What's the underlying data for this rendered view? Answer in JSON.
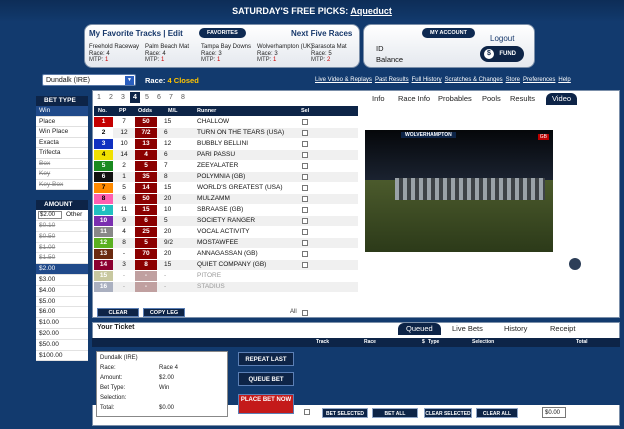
{
  "header": {
    "promo": "SATURDAY'S FREE PICKS:",
    "promo_link": "Aqueduct"
  },
  "favorites": {
    "title": "My Favorite Tracks | Edit",
    "pill": "FAVORITES",
    "next_title": "Next Five Races",
    "tracks": [
      {
        "name": "Freehold Raceway",
        "race": "Race: 4",
        "mtp": "1"
      },
      {
        "name": "Palm Beach Mat",
        "race": "Race: 4",
        "mtp": "1"
      },
      {
        "name": "Tampa Bay Downs",
        "race": "Race: 3",
        "mtp": "1"
      },
      {
        "name": "Wolverhampton (UK)",
        "race": "Race: 3",
        "mtp": "1"
      },
      {
        "name": "Sarasota Mat",
        "race": "Race: 5",
        "mtp": "2"
      }
    ]
  },
  "account": {
    "pill": "MY ACCOUNT",
    "id_label": "ID",
    "balance_label": "Balance",
    "logout": "Logout",
    "fund": "FUND"
  },
  "race_bar": {
    "track": "Dundalk (IRE)",
    "race": "Race:",
    "race_num": "4",
    "status": "Closed",
    "links": [
      "Live Video & Replays",
      "Past Results",
      "Full History",
      "Scratches & Changes",
      "Store",
      "Preferences",
      "Help"
    ]
  },
  "bet_type": {
    "title": "BET TYPE",
    "options": [
      {
        "label": "Win",
        "state": "sel"
      },
      {
        "label": "Place",
        "state": ""
      },
      {
        "label": "Win Place",
        "state": ""
      },
      {
        "label": "Exacta",
        "state": ""
      },
      {
        "label": "Trifecta",
        "state": ""
      },
      {
        "label": "Box",
        "state": "dis"
      },
      {
        "label": "Key",
        "state": "dis"
      },
      {
        "label": "Key Box",
        "state": "dis"
      }
    ]
  },
  "amount": {
    "title": "AMOUNT",
    "input": "$2.00",
    "other": "Other",
    "options": [
      {
        "label": "$0.10",
        "state": "dis"
      },
      {
        "label": "$0.50",
        "state": "dis"
      },
      {
        "label": "$1.00",
        "state": "dis"
      },
      {
        "label": "$1.50",
        "state": "dis"
      },
      {
        "label": "$2.00",
        "state": "sel"
      },
      {
        "label": "$3.00",
        "state": ""
      },
      {
        "label": "$4.00",
        "state": ""
      },
      {
        "label": "$5.00",
        "state": ""
      },
      {
        "label": "$6.00",
        "state": ""
      },
      {
        "label": "$10.00",
        "state": ""
      },
      {
        "label": "$20.00",
        "state": ""
      },
      {
        "label": "$50.00",
        "state": ""
      },
      {
        "label": "$100.00",
        "state": ""
      }
    ]
  },
  "race_tabs": [
    "1",
    "2",
    "3",
    "4",
    "5",
    "6",
    "7",
    "8"
  ],
  "race_tab_selected": "4",
  "grid": {
    "headers": [
      "No.",
      "PP",
      "Odds",
      "M/L",
      "Runner",
      "Sel"
    ],
    "runners": [
      {
        "no": "1",
        "pp": "7",
        "odds": "50",
        "ml": "15",
        "name": "CHALLOW",
        "color": "#c40000"
      },
      {
        "no": "2",
        "pp": "12",
        "odds": "7/2",
        "ml": "6",
        "name": "TURN ON THE TEARS (USA)",
        "color": "#ffffff",
        "fg": "#000"
      },
      {
        "no": "3",
        "pp": "10",
        "odds": "13",
        "ml": "12",
        "name": "BUBBLY BELLINI",
        "color": "#1030c0"
      },
      {
        "no": "4",
        "pp": "14",
        "odds": "4",
        "ml": "6",
        "name": "PARI PASSU",
        "color": "#f0e000",
        "fg": "#000"
      },
      {
        "no": "5",
        "pp": "2",
        "odds": "5",
        "ml": "7",
        "name": "ZEEYALATER",
        "color": "#1a8a20"
      },
      {
        "no": "6",
        "pp": "1",
        "odds": "35",
        "ml": "8",
        "name": "POLYMNIA (GB)",
        "color": "#111111"
      },
      {
        "no": "7",
        "pp": "5",
        "odds": "14",
        "ml": "15",
        "name": "WORLD'S GREATEST (USA)",
        "color": "#ff8a00",
        "fg": "#000"
      },
      {
        "no": "8",
        "pp": "6",
        "odds": "50",
        "ml": "20",
        "name": "MULZAMM",
        "color": "#ff5fb0",
        "fg": "#000"
      },
      {
        "no": "9",
        "pp": "11",
        "odds": "15",
        "ml": "10",
        "name": "SBRAASE (GB)",
        "color": "#20c0c0"
      },
      {
        "no": "10",
        "pp": "9",
        "odds": "6",
        "ml": "5",
        "name": "SOCIETY RANGER",
        "color": "#7a2fb0"
      },
      {
        "no": "11",
        "pp": "4",
        "odds": "25",
        "ml": "20",
        "name": "VOCAL ACTIVITY",
        "color": "#888888"
      },
      {
        "no": "12",
        "pp": "8",
        "odds": "5",
        "ml": "9/2",
        "name": "MOSTAWFEE",
        "color": "#5ab020"
      },
      {
        "no": "13",
        "pp": "-",
        "odds": "70",
        "ml": "20",
        "name": "ANNAGASSAN (GB)",
        "color": "#6b2a10"
      },
      {
        "no": "14",
        "pp": "3",
        "odds": "8",
        "ml": "15",
        "name": "QUIET COMPANY (GB)",
        "color": "#8b0030"
      },
      {
        "no": "15",
        "pp": "-",
        "odds": "-",
        "ml": "-",
        "name": "PITORE",
        "color": "#c8c8a0",
        "scr": true
      },
      {
        "no": "16",
        "pp": "-",
        "odds": "-",
        "ml": "-",
        "name": "STADIUS",
        "color": "#aab0c0",
        "scr": true
      }
    ]
  },
  "grid_buttons": {
    "clear": "CLEAR",
    "copy": "COPY LEG",
    "all": "All"
  },
  "info_tabs": [
    "Info",
    "Race Info",
    "Probables",
    "Pools",
    "Results",
    "Video"
  ],
  "video": {
    "caption": "WOLVERHAMPTON",
    "logo": "GB"
  },
  "ticket": {
    "title": "Your Ticket",
    "tabs": [
      "Queued",
      "Live Bets",
      "History",
      "Receipt"
    ],
    "cols": [
      "Track",
      "Race",
      "$",
      "Type",
      "Selection",
      "Total"
    ],
    "summary": [
      {
        "label": "Dundalk (IRE)",
        "value": ""
      },
      {
        "label": "Race:",
        "value": "Race 4"
      },
      {
        "label": "Amount:",
        "value": "$2.00"
      },
      {
        "label": "Bet Type:",
        "value": "Win"
      },
      {
        "label": "Selection:",
        "value": ""
      },
      {
        "label": "Total:",
        "value": "$0.00"
      }
    ],
    "repeat": "REPEAT LAST",
    "queue": "QUEUE BET",
    "place": "PLACE BET NOW",
    "bottom_all": "All",
    "bet_selected": "BET SELECTED",
    "bet_all": "BET ALL",
    "clear_selected": "CLEAR SELECTED",
    "clear_all": "CLEAR ALL",
    "total_label": "Total",
    "total_value": "$0.00"
  }
}
